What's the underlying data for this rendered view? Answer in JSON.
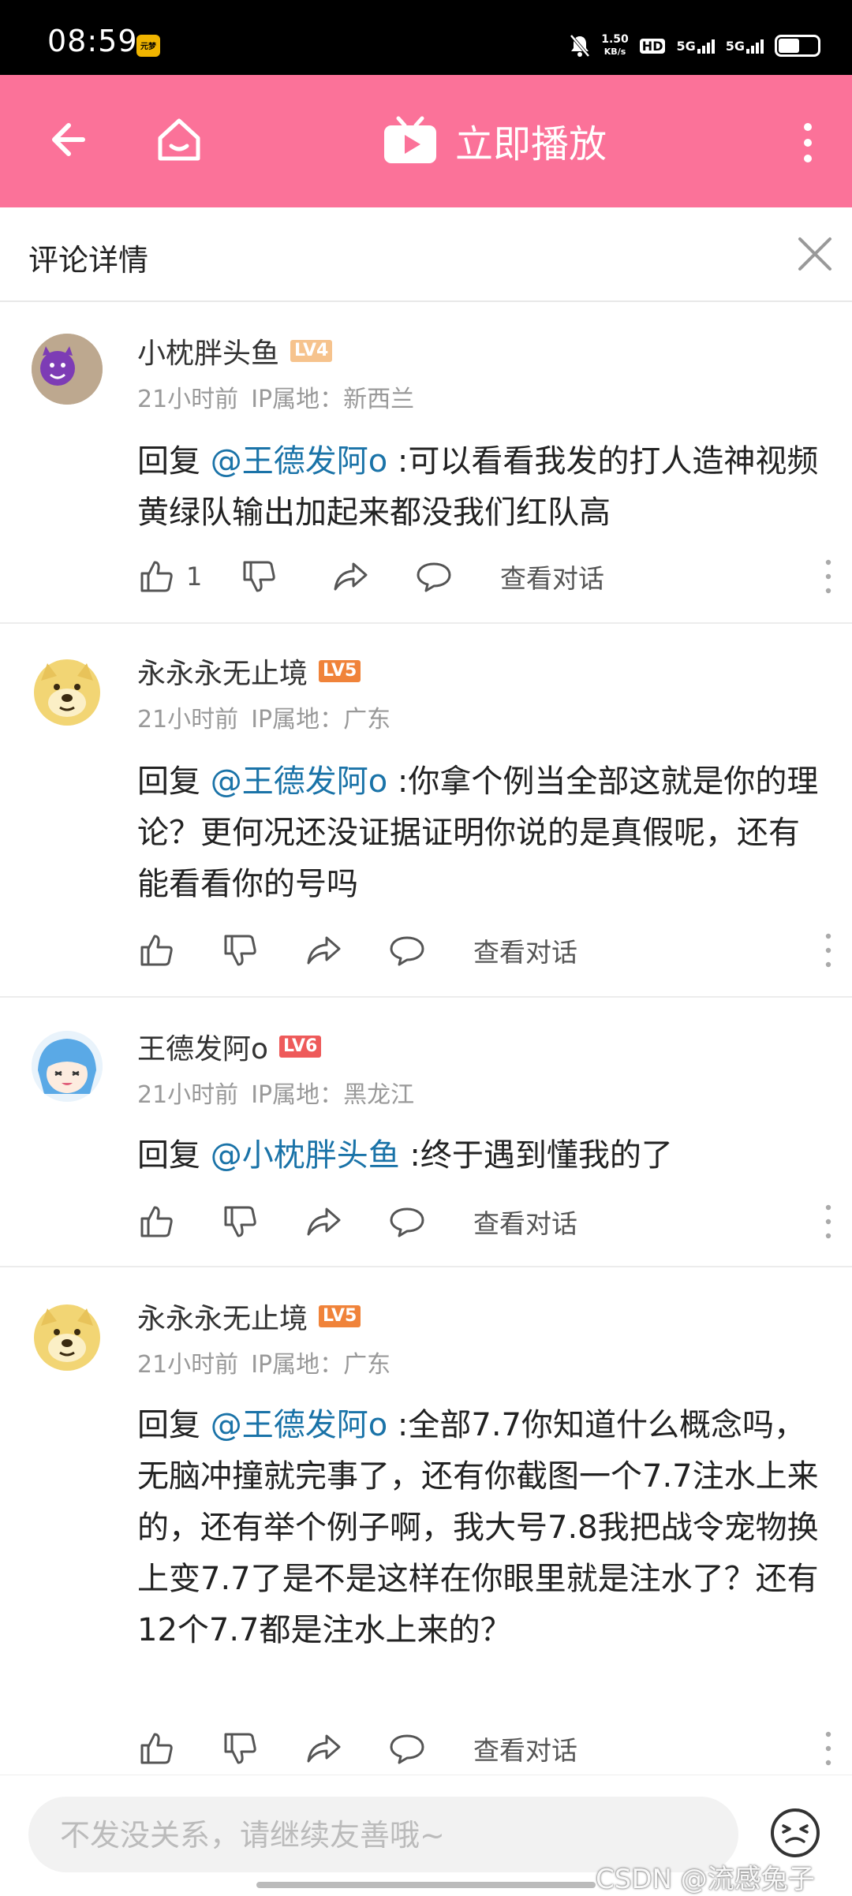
{
  "status_bar": {
    "time": "08:59",
    "notification_badge": "元梦",
    "net_speed_value": "1.50",
    "net_speed_unit": "KB/s",
    "hd_label": "HD",
    "sim1_label": "5G",
    "sim2_label": "5G"
  },
  "app_bar": {
    "play_label": "立即播放",
    "background_color": "#fb7299"
  },
  "detail_header": {
    "title": "评论详情"
  },
  "comments": [
    {
      "username": "小枕胖头鱼",
      "level": "LV4",
      "level_color": "#f6c38d",
      "time": "21小时前",
      "ip": "IP属地：新西兰",
      "reply_prefix": "回复 ",
      "mention": "@王德发阿o",
      "text": " :可以看看我发的打人造神视频黄绿队输出加起来都没我们红队高",
      "like_count": "1",
      "view_dialog_label": "查看对话"
    },
    {
      "username": "永永永无止境",
      "level": "LV5",
      "level_color": "#f0833a",
      "time": "21小时前",
      "ip": "IP属地：广东",
      "reply_prefix": "回复 ",
      "mention": "@王德发阿o",
      "text": " :你拿个例当全部这就是你的理论？更何况还没证据证明你说的是真假呢，还有能看看你的号吗",
      "like_count": "",
      "view_dialog_label": "查看对话"
    },
    {
      "username": "王德发阿o",
      "level": "LV6",
      "level_color": "#ee5a5a",
      "time": "21小时前",
      "ip": "IP属地：黑龙江",
      "reply_prefix": "回复 ",
      "mention": "@小枕胖头鱼",
      "text": " :终于遇到懂我的了",
      "like_count": "",
      "view_dialog_label": "查看对话"
    },
    {
      "username": "永永永无止境",
      "level": "LV5",
      "level_color": "#f0833a",
      "time": "21小时前",
      "ip": "IP属地：广东",
      "reply_prefix": "回复 ",
      "mention": "@王德发阿o",
      "text": " :全部7.7你知道什么概念吗，无脑冲撞就完事了，还有你截图一个7.7注水上来的，还有举个例子啊，我大号7.8我把战令宠物换上变7.7了是不是这样在你眼里就是注水了？还有12个7.7都是注水上来的？",
      "like_count": "",
      "view_dialog_label": "查看对话"
    }
  ],
  "input": {
    "placeholder": "不发没关系，请继续友善哦~"
  },
  "watermark": "CSDN @流感兔子",
  "colors": {
    "accent": "#fb7299",
    "mention": "#1a73a8"
  }
}
